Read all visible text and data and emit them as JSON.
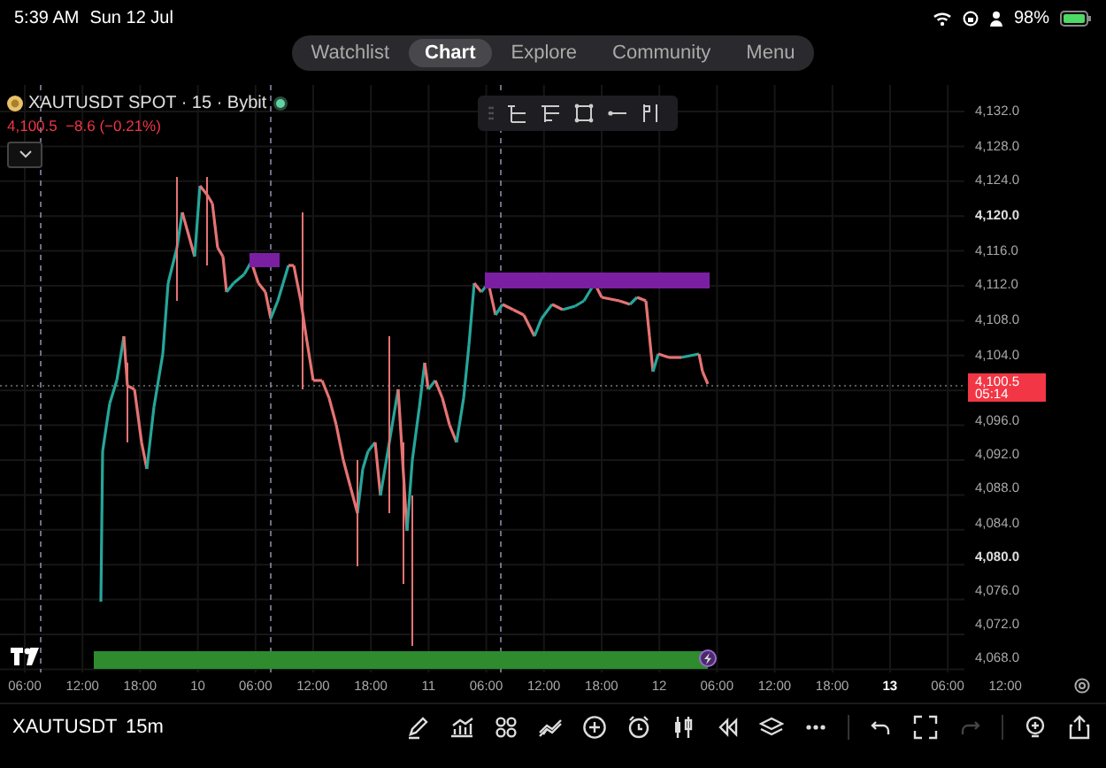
{
  "status_bar": {
    "time": "5:39 AM",
    "date": "Sun 12 Jul",
    "battery": "98%"
  },
  "nav_tabs": [
    {
      "label": "Watchlist",
      "selected": false
    },
    {
      "label": "Chart",
      "selected": true
    },
    {
      "label": "Explore",
      "selected": false
    },
    {
      "label": "Community",
      "selected": false
    },
    {
      "label": "Menu",
      "selected": false
    }
  ],
  "symbol": {
    "title": "XAUTUSDT SPOT · 15 · Bybit",
    "quote": "4,100.5  −8.6 (−0.21%)"
  },
  "price_axis_upper": [
    {
      "text": "4,132.0",
      "bold": false
    },
    {
      "text": "4,128.0",
      "bold": false
    },
    {
      "text": "4,124.0",
      "bold": false
    },
    {
      "text": "4,120.0",
      "bold": true
    },
    {
      "text": "4,116.0",
      "bold": false
    },
    {
      "text": "4,112.0",
      "bold": false
    },
    {
      "text": "4,108.0",
      "bold": false
    },
    {
      "text": "4,104.0",
      "bold": false
    }
  ],
  "price_axis_lower": [
    {
      "text": "4,096.0",
      "bold": false
    },
    {
      "text": "4,092.0",
      "bold": false
    },
    {
      "text": "4,088.0",
      "bold": false
    },
    {
      "text": "4,084.0",
      "bold": false
    },
    {
      "text": "4,080.0",
      "bold": true
    },
    {
      "text": "4,076.0",
      "bold": false
    },
    {
      "text": "4,072.0",
      "bold": false
    },
    {
      "text": "4,068.0",
      "bold": false
    }
  ],
  "current_price": {
    "price": "4,100.5",
    "countdown": "05:14"
  },
  "time_axis": [
    {
      "text": "06:00",
      "bold": false
    },
    {
      "text": "12:00",
      "bold": false
    },
    {
      "text": "18:00",
      "bold": false
    },
    {
      "text": "10",
      "bold": false
    },
    {
      "text": "06:00",
      "bold": false
    },
    {
      "text": "12:00",
      "bold": false
    },
    {
      "text": "18:00",
      "bold": false
    },
    {
      "text": "11",
      "bold": false
    },
    {
      "text": "06:00",
      "bold": false
    },
    {
      "text": "12:00",
      "bold": false
    },
    {
      "text": "18:00",
      "bold": false
    },
    {
      "text": "12",
      "bold": false
    },
    {
      "text": "06:00",
      "bold": false
    },
    {
      "text": "12:00",
      "bold": false
    },
    {
      "text": "18:00",
      "bold": false
    },
    {
      "text": "13",
      "bold": true
    },
    {
      "text": "06:00",
      "bold": false
    },
    {
      "text": "12:00",
      "bold": false
    }
  ],
  "bottom_bar": {
    "symbol": "XAUTUSDT",
    "interval": "15m",
    "redo_disabled": true
  }
}
